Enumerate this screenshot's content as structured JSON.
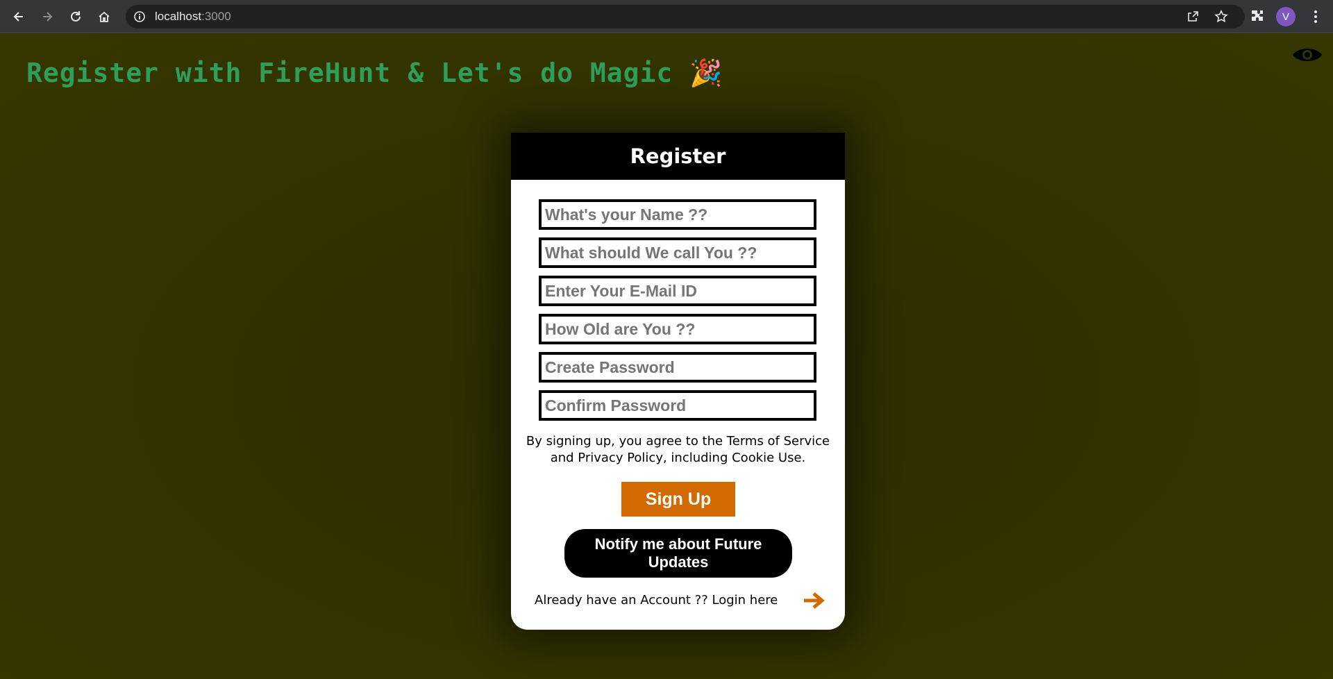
{
  "browser": {
    "url_host": "localhost",
    "url_port": ":3000",
    "profile_initial": "V",
    "icons": [
      "back-icon",
      "forward-icon",
      "reload-icon",
      "home-icon",
      "info-icon",
      "share-icon",
      "star-icon",
      "extensions-icon",
      "menu-icon"
    ]
  },
  "page": {
    "title": "Register with FireHunt & Let's do Magic",
    "title_emoji": "🎉",
    "eye_icon": "eye-icon"
  },
  "card": {
    "header": "Register",
    "fields": {
      "name_placeholder": "What's your Name ??",
      "nickname_placeholder": "What should We call You ??",
      "email_placeholder": "Enter Your E-Mail ID",
      "age_placeholder": "How Old are You ??",
      "password_placeholder": "Create Password",
      "confirm_placeholder": "Confirm Password"
    },
    "terms_line1": "By signing up, you agree to the Terms of Service",
    "terms_line2": "and Privacy Policy, including Cookie Use.",
    "signup_label": "Sign Up",
    "notify_label": "Notify me about Future Updates",
    "login_text": "Already have an Account ?? Login here"
  },
  "colors": {
    "background": "#333300",
    "title": "#2e9e5a",
    "accent": "#d36a00",
    "card": "#ffffff",
    "header": "#000000"
  }
}
